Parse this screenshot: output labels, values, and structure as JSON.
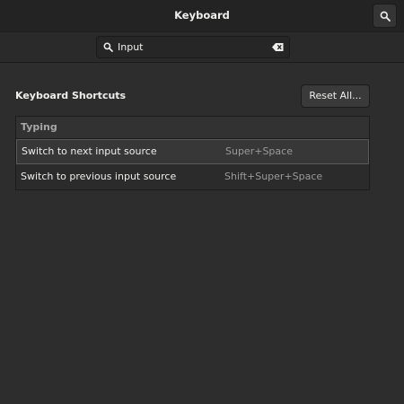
{
  "window": {
    "title": "Keyboard"
  },
  "header": {
    "search_button_icon": "search-icon"
  },
  "search": {
    "value": "Input",
    "icon": "search-icon",
    "clear_icon": "edit-clear-icon"
  },
  "section": {
    "title": "Keyboard Shortcuts",
    "reset_label": "Reset All..."
  },
  "shortcuts": {
    "group": "Typing",
    "rows": [
      {
        "label": "Switch to next input source",
        "accel": "Super+Space",
        "selected": true
      },
      {
        "label": "Switch to previous input source",
        "accel": "Shift+Super+Space",
        "selected": false
      }
    ]
  },
  "colors": {
    "background": "#2d2d2d",
    "headerbar": "#232323",
    "text": "#eeeeec",
    "muted_text": "#9a9a9a"
  }
}
